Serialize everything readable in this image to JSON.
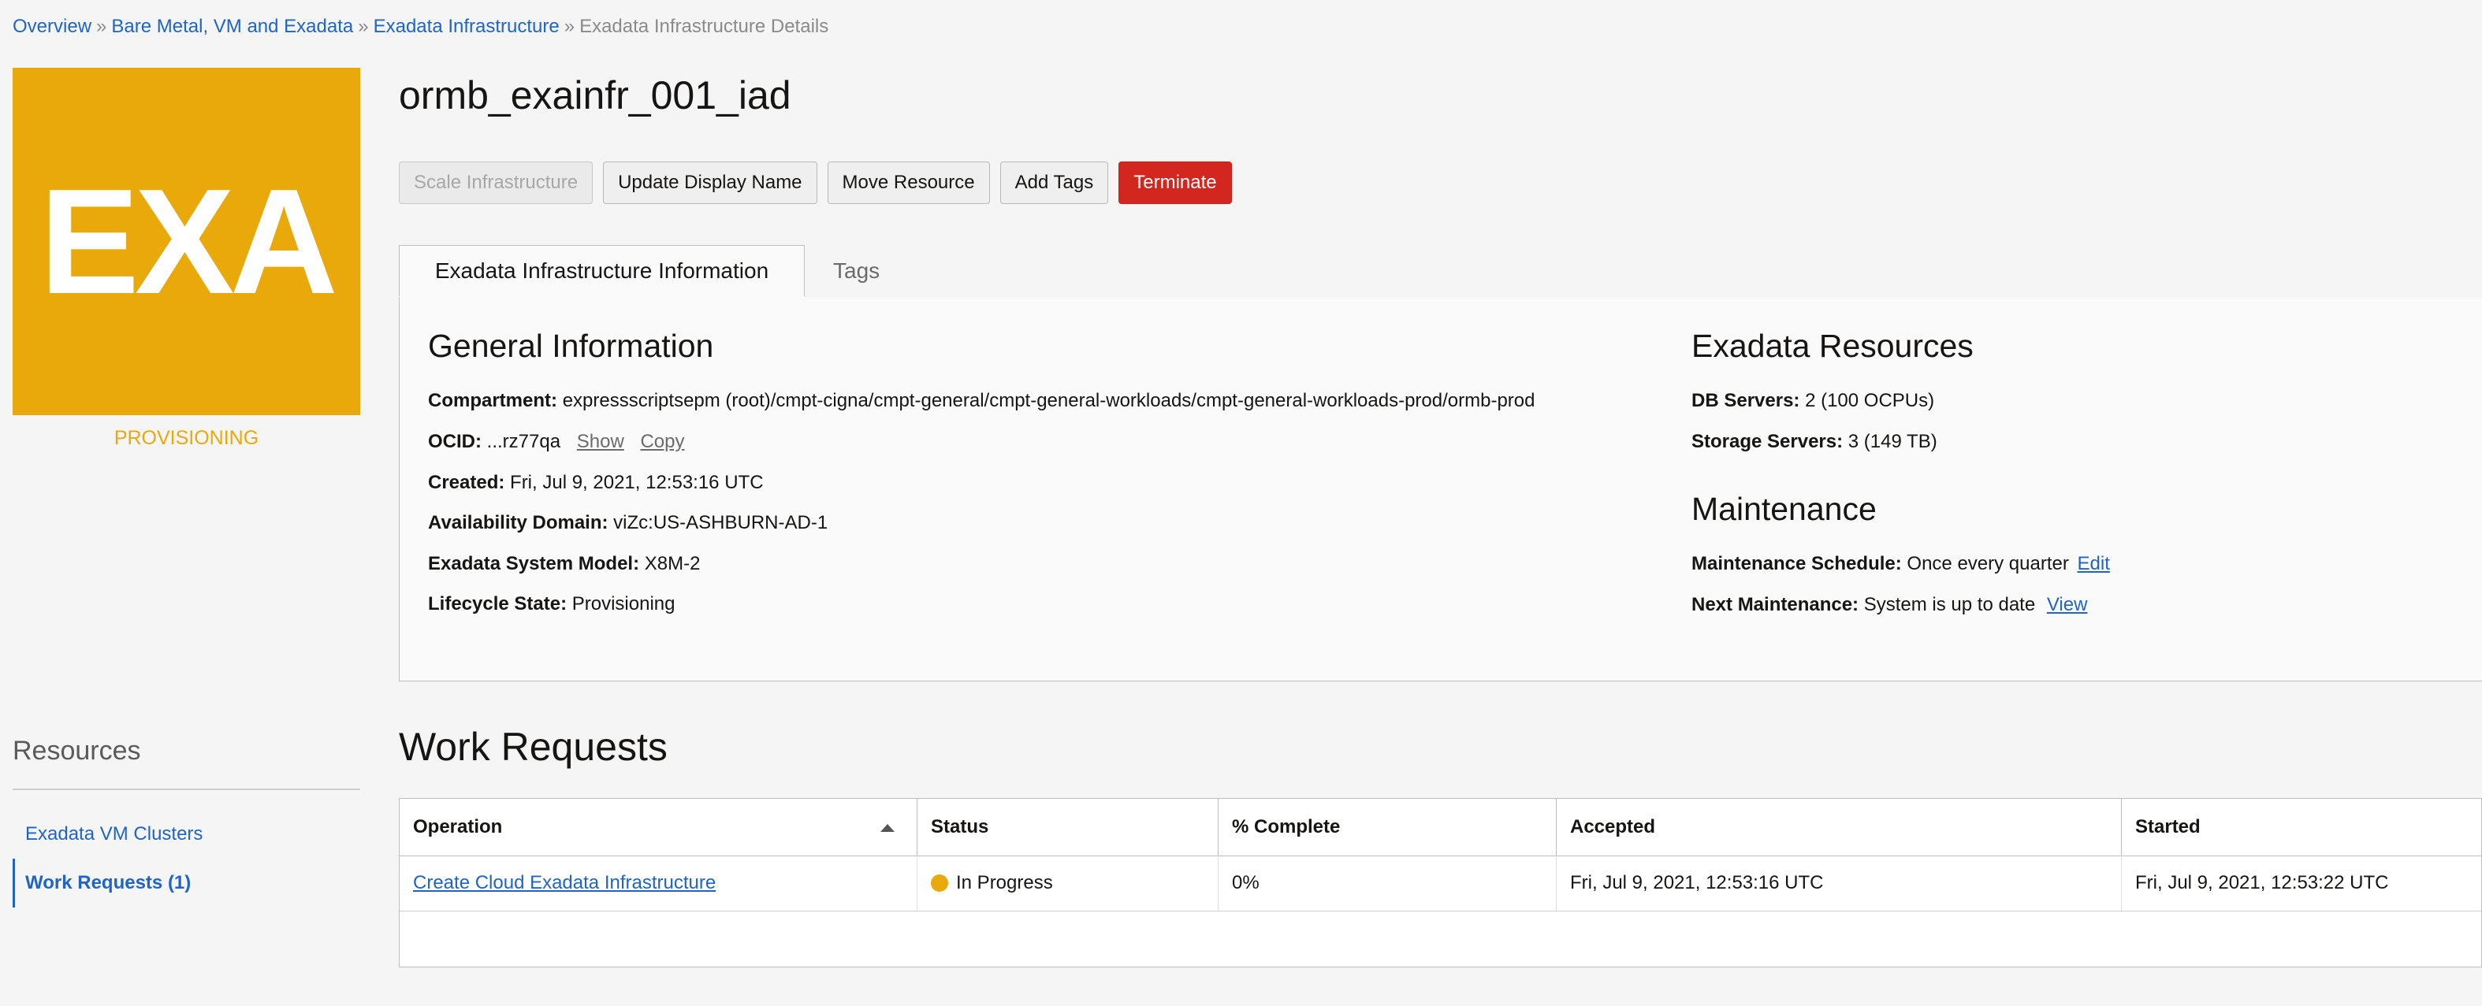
{
  "breadcrumb": {
    "items": [
      "Overview",
      "Bare Metal, VM and Exadata",
      "Exadata Infrastructure"
    ],
    "current": "Exadata Infrastructure Details",
    "separator": "»"
  },
  "logo": {
    "text": "EXA",
    "status": "PROVISIONING",
    "color": "#e9a90b"
  },
  "title": "ormb_exainfr_001_iad",
  "actions": {
    "scale": "Scale Infrastructure",
    "update_name": "Update Display Name",
    "move": "Move Resource",
    "add_tags": "Add Tags",
    "terminate": "Terminate"
  },
  "tabs": {
    "info": "Exadata Infrastructure Information",
    "tags": "Tags"
  },
  "general": {
    "heading": "General Information",
    "compartment_label": "Compartment:",
    "compartment": "expressscriptsepm (root)/cmpt-cigna/cmpt-general/cmpt-general-workloads/cmpt-general-workloads-prod/ormb-prod",
    "ocid_label": "OCID:",
    "ocid": "...rz77qa",
    "show": "Show",
    "copy": "Copy",
    "created_label": "Created:",
    "created": "Fri, Jul 9, 2021, 12:53:16 UTC",
    "ad_label": "Availability Domain:",
    "ad": "viZc:US-ASHBURN-AD-1",
    "model_label": "Exadata System Model:",
    "model": "X8M-2",
    "lifecycle_label": "Lifecycle State:",
    "lifecycle": "Provisioning"
  },
  "resources_info": {
    "heading": "Exadata Resources",
    "db_label": "DB Servers:",
    "db": "2 (100 OCPUs)",
    "storage_label": "Storage Servers:",
    "storage": "3 (149 TB)"
  },
  "maintenance": {
    "heading": "Maintenance",
    "schedule_label": "Maintenance Schedule:",
    "schedule": "Once every quarter",
    "edit": "Edit",
    "next_label": "Next Maintenance:",
    "next": "System is up to date",
    "view": "View"
  },
  "sidebar": {
    "title": "Resources",
    "items": [
      "Exadata VM Clusters",
      "Work Requests (1)"
    ]
  },
  "work_requests": {
    "title": "Work Requests",
    "columns": [
      "Operation",
      "Status",
      "% Complete",
      "Accepted",
      "Started"
    ],
    "rows": [
      {
        "operation": "Create Cloud Exadata Infrastructure",
        "status": "In Progress",
        "percent": "0%",
        "accepted": "Fri, Jul 9, 2021, 12:53:16 UTC",
        "started": "Fri, Jul 9, 2021, 12:53:22 UTC"
      }
    ]
  }
}
